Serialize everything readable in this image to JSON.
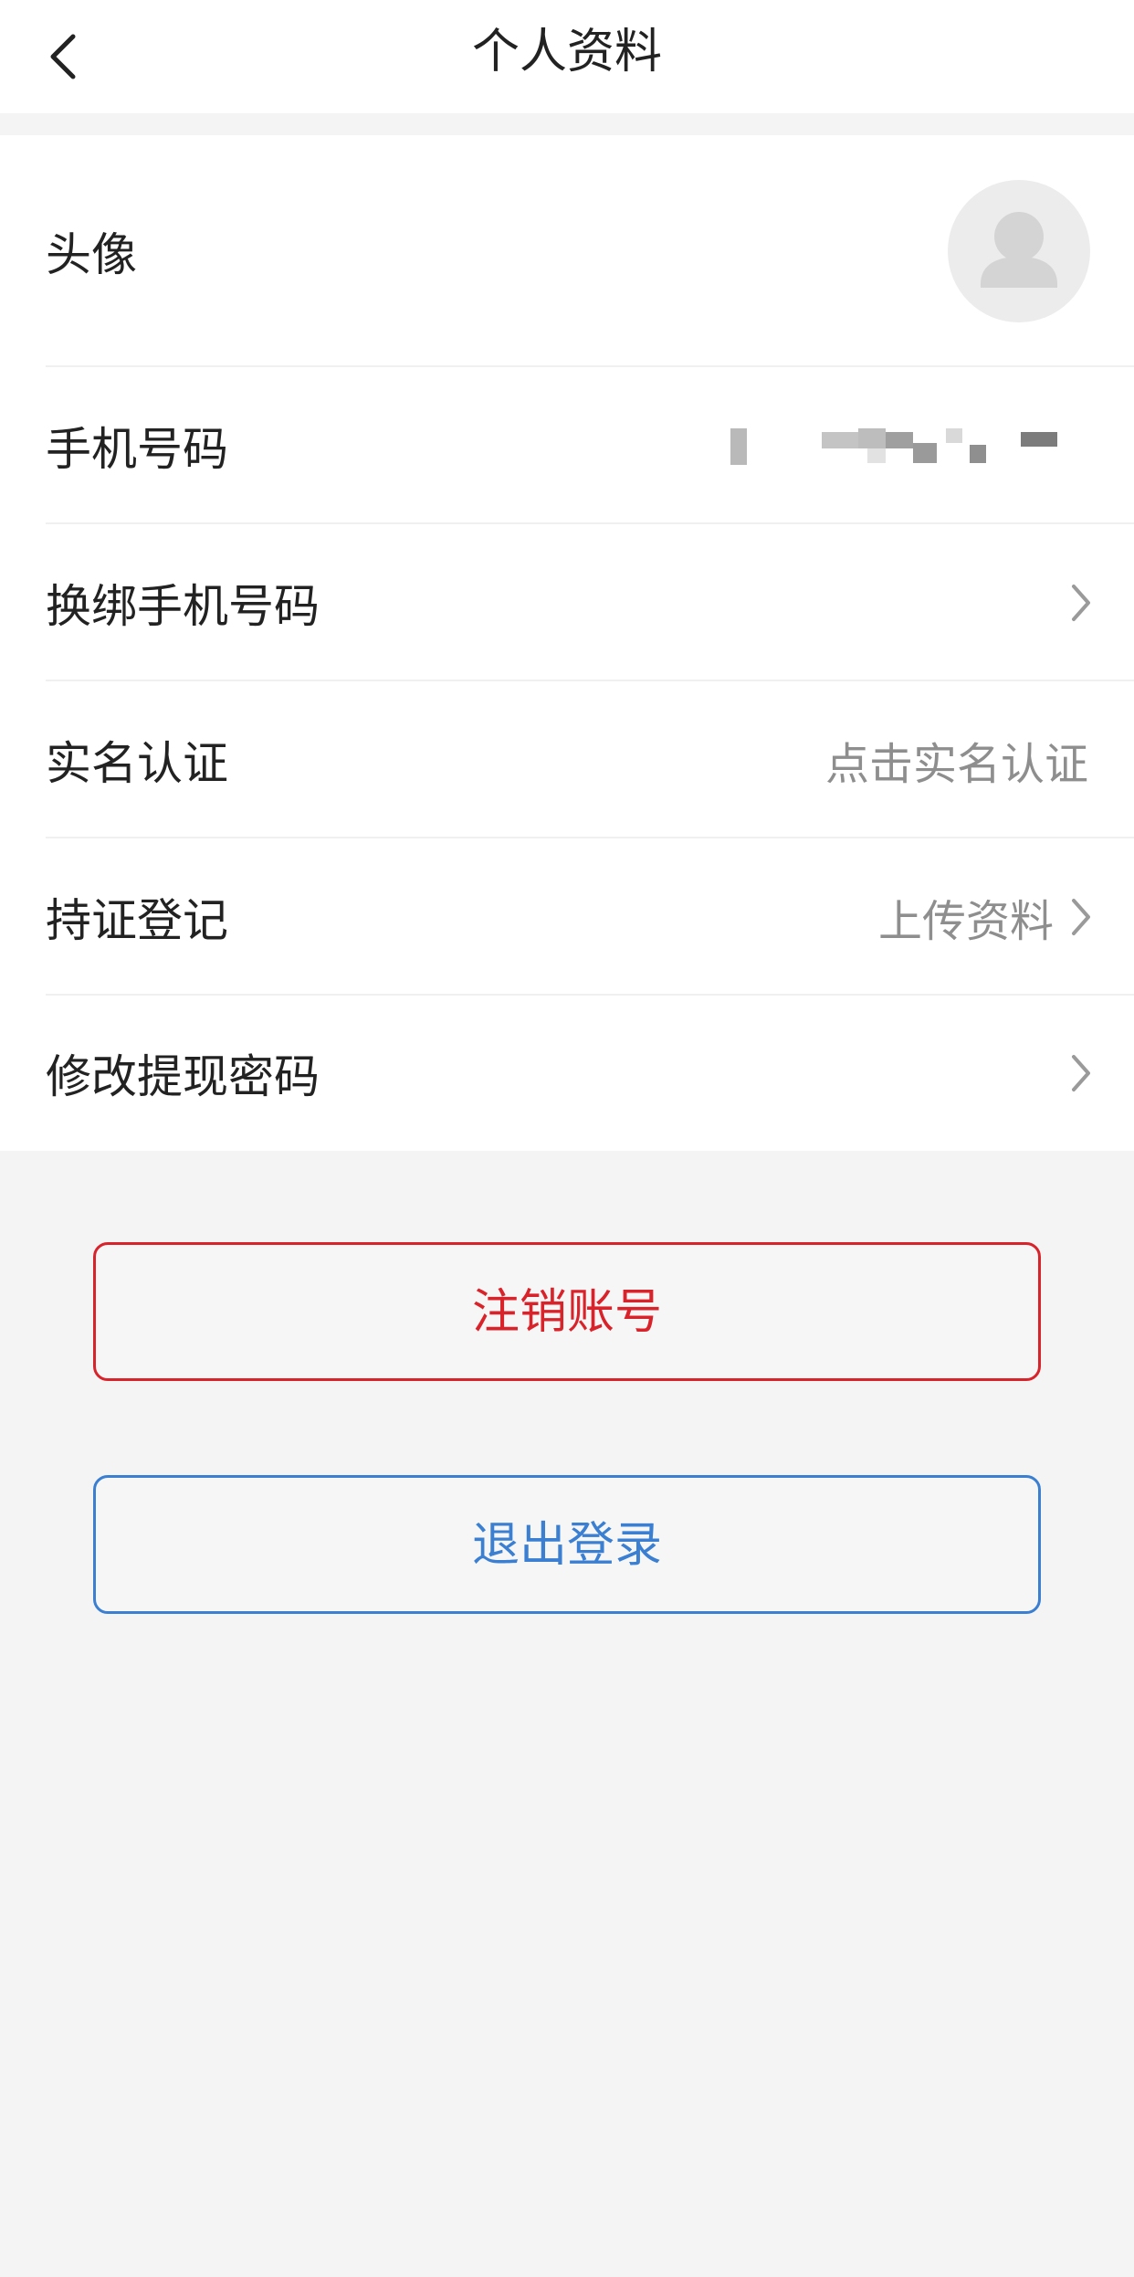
{
  "header": {
    "title": "个人资料"
  },
  "rows": [
    {
      "label": "头像"
    },
    {
      "label": "手机号码"
    },
    {
      "label": "换绑手机号码"
    },
    {
      "label": "实名认证",
      "value": "点击实名认证"
    },
    {
      "label": "持证登记",
      "value": "上传资料"
    },
    {
      "label": "修改提现密码"
    }
  ],
  "buttons": {
    "cancel_account": "注销账号",
    "logout": "退出登录"
  },
  "colors": {
    "danger": "#d9232b",
    "link": "#3a7fd1"
  },
  "icons": {
    "back": "chevron-left-icon",
    "avatar": "user-placeholder-icon",
    "arrow": "chevron-right-icon"
  }
}
